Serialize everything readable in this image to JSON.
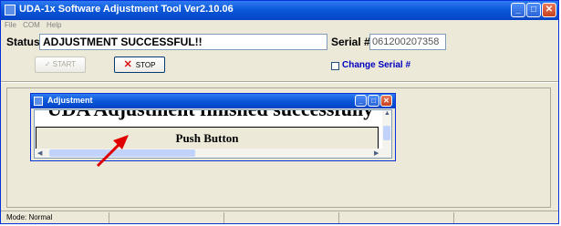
{
  "window": {
    "title": "UDA-1x Software Adjustment Tool Ver2.10.06",
    "minimize": "_",
    "maximize": "□",
    "close": "✕"
  },
  "menu": [
    "File",
    "COM",
    "Help"
  ],
  "status": {
    "label": "Status",
    "value": "ADJUSTMENT SUCCESSFUL!!"
  },
  "serial": {
    "label": "Serial #",
    "value": "061200207358"
  },
  "buttons": {
    "start": "START",
    "stop": "STOP",
    "change_serial": "Change Serial #"
  },
  "dialog": {
    "title": "Adjustment",
    "message": "UDA Adjustment finished successfully",
    "push_button": "Push Button",
    "minimize": "_",
    "maximize": "□",
    "close": "✕"
  },
  "statusbar": {
    "mode": "Mode: Normal"
  },
  "icons": {
    "stop": "x-icon",
    "start": "check-icon"
  },
  "colors": {
    "titlebar": "#0a57d8",
    "arrow": "#e00000",
    "stop_icon": "#dd1111"
  }
}
